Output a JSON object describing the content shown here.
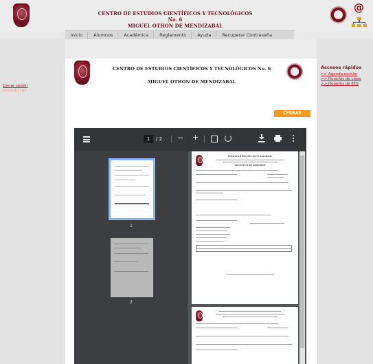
{
  "header": {
    "title_line1": "CENTRO DE ESTUDIOS CIENTÍFICOS Y TECNOLÓGICOS No. 6",
    "title_line2": "MIGUEL OTHON DE MENDIZABAL",
    "left_logo_icon": "ipn-crest-icon",
    "right_logo_icon": "cecyt-seal-icon",
    "email_icon": "at-sign-icon",
    "sitemap_icon": "sitemap-icon"
  },
  "nav": {
    "items": [
      "Inicio",
      "Alumnos",
      "Académica",
      "Reglamento",
      "Ayuda",
      "Recuperar Contraseña"
    ]
  },
  "sidebar": {
    "logout_label": "Cerrar sesión",
    "user_id": "2022061187"
  },
  "main": {
    "title_line1": "CENTRO DE ESTUDIOS CIENTÍFICOS Y TECNOLÓGICOS No. 6",
    "title_line2": "MIGUEL OTHON DE MENDIZABAL",
    "close_label": "CERRAR"
  },
  "quick_access": {
    "title": "Accesos rápidos",
    "links": [
      ">> Agenda escolar",
      ">> Horarios de clase",
      ">> Horarios de ETS"
    ]
  },
  "pdf_viewer": {
    "current_page": "1",
    "page_total": "/ 2",
    "thumb_labels": [
      "1",
      "2"
    ],
    "doc_heading": "INSTITUTO POLITÉCNICO NACIONAL",
    "doc_subheading": "SOLICITUD DE ADMISIÓN"
  },
  "colors": {
    "brand": "#7a1224",
    "close_button": "#f59a19",
    "toolbar": "#323639"
  }
}
